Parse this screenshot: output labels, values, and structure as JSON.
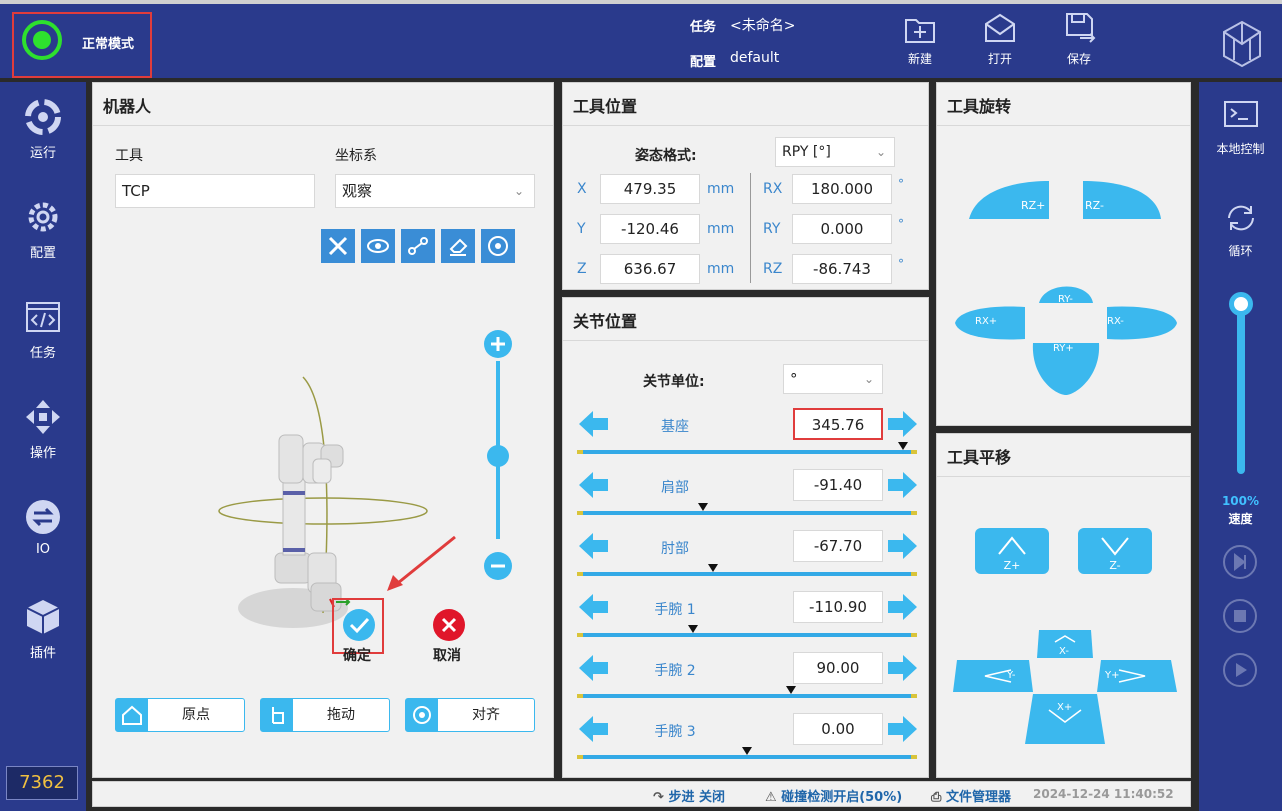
{
  "header": {
    "mode_label": "正常模式",
    "task_label": "任务",
    "task_value": "<未命名>",
    "config_label": "配置",
    "config_value": "default",
    "buttons": {
      "new": "新建",
      "open": "打开",
      "save": "保存"
    }
  },
  "sidebar": {
    "items": [
      {
        "label": "运行",
        "icon": "run-icon"
      },
      {
        "label": "配置",
        "icon": "gear-icon"
      },
      {
        "label": "任务",
        "icon": "code-icon"
      },
      {
        "label": "操作",
        "icon": "move-icon"
      },
      {
        "label": "IO",
        "icon": "io-icon"
      },
      {
        "label": "插件",
        "icon": "cube-icon"
      }
    ],
    "counter": "7362"
  },
  "rightbar": {
    "local_control": "本地控制",
    "loop": "循环",
    "speed_value": "100%",
    "speed_label": "速度",
    "speed_fraction": 1.0
  },
  "robot_panel": {
    "title": "机器人",
    "tool_label": "工具",
    "tool_value": "TCP",
    "frame_label": "坐标系",
    "frame_value": "观察",
    "confirm": "确定",
    "cancel": "取消",
    "home": "原点",
    "drag": "拖动",
    "align": "对齐"
  },
  "tool_position": {
    "title": "工具位置",
    "format_label": "姿态格式:",
    "format_value": "RPY [°]",
    "rows": [
      {
        "axis": "X",
        "value": "479.35",
        "unit": "mm",
        "raxis": "RX",
        "rvalue": "180.000",
        "runit": "°"
      },
      {
        "axis": "Y",
        "value": "-120.46",
        "unit": "mm",
        "raxis": "RY",
        "rvalue": "0.000",
        "runit": "°"
      },
      {
        "axis": "Z",
        "value": "636.67",
        "unit": "mm",
        "raxis": "RZ",
        "rvalue": "-86.743",
        "runit": "°"
      }
    ]
  },
  "joint_position": {
    "title": "关节位置",
    "unit_label": "关节单位:",
    "unit_value": "°",
    "joints": [
      {
        "name": "基座",
        "value": "345.76",
        "fraction": 0.96
      },
      {
        "name": "肩部",
        "value": "-91.40",
        "fraction": 0.37
      },
      {
        "name": "肘部",
        "value": "-67.70",
        "fraction": 0.4
      },
      {
        "name": "手腕 1",
        "value": "-110.90",
        "fraction": 0.34
      },
      {
        "name": "手腕 2",
        "value": "90.00",
        "fraction": 0.63
      },
      {
        "name": "手腕 3",
        "value": "0.00",
        "fraction": 0.5
      }
    ]
  },
  "tool_rotation": {
    "title": "工具旋转",
    "buttons": {
      "rz_plus": "RZ+",
      "rz_minus": "RZ-",
      "ry_minus": "RY-",
      "rx_plus": "RX+",
      "rx_minus": "RX-",
      "ry_plus": "RY+"
    }
  },
  "tool_translation": {
    "title": "工具平移",
    "buttons": {
      "z_plus": "Z+",
      "z_minus": "Z-",
      "x_minus": "X-",
      "y_minus": "Y-",
      "y_plus": "Y+",
      "x_plus": "X+"
    }
  },
  "statusbar": {
    "step": "步进 关闭",
    "collision": "碰撞检测开启(50%)",
    "files": "文件管理器",
    "datetime": "2024-12-24 11:40:52"
  }
}
